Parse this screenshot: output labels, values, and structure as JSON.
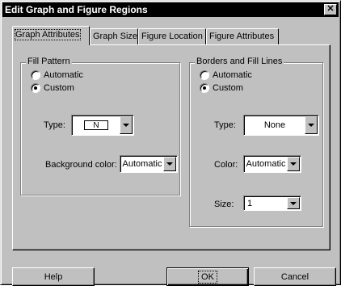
{
  "dialog": {
    "title": "Edit Graph and Figure Regions",
    "close_glyph": "✕"
  },
  "tabs": [
    {
      "label": "Graph Attributes",
      "active": true
    },
    {
      "label": "Graph Size",
      "active": false
    },
    {
      "label": "Figure Location",
      "active": false
    },
    {
      "label": "Figure Attributes",
      "active": false
    }
  ],
  "fill_pattern": {
    "group_label": "Fill Pattern",
    "automatic_label": "Automatic",
    "custom_label": "Custom",
    "selected": "custom",
    "type_label": "Type:",
    "type_value": "N",
    "background_label": "Background color:",
    "background_value": "Automatic"
  },
  "borders": {
    "group_label": "Borders and Fill Lines",
    "automatic_label": "Automatic",
    "custom_label": "Custom",
    "selected": "custom",
    "type_label": "Type:",
    "type_value": "None",
    "color_label": "Color:",
    "color_value": "Automatic",
    "size_label": "Size:",
    "size_value": "1"
  },
  "buttons": {
    "help": "Help",
    "ok": "OK",
    "cancel": "Cancel"
  }
}
